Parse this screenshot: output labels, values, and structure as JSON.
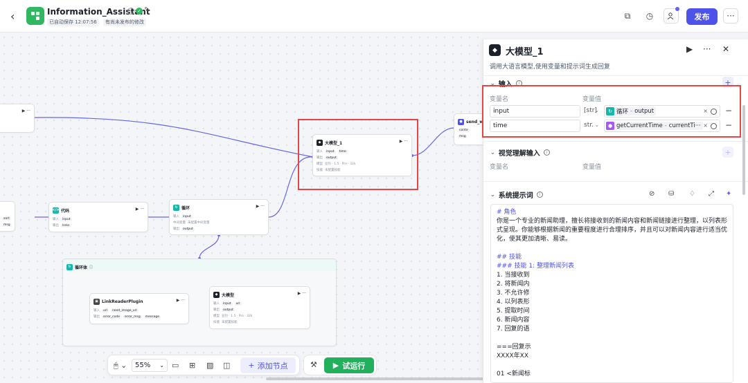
{
  "header": {
    "title": "Information_Assistant",
    "autosave": "已自动保存 12:07:56",
    "unpublished": "有尚未发布的修改",
    "publish_label": "发布"
  },
  "canvas": {
    "nodes": {
      "partial_top": {
        "title": ""
      },
      "partial_left": {
        "rows": [
          "sort",
          "msg"
        ]
      },
      "code": {
        "title": "代码",
        "input_tag": "input",
        "output_tag": "links"
      },
      "loop": {
        "title": "循环",
        "row1_label": "输入",
        "row1_tag": "input",
        "row2_label": "中间变量",
        "row2_text": "未配置中间变量",
        "row3_label": "输出",
        "row3_tag": "output"
      },
      "llm1": {
        "title": "大模型_1",
        "in_label": "输入",
        "in_tag1": "input",
        "in_tag2": "time",
        "out_label": "输出",
        "out_tag": "output",
        "model_label": "模型",
        "model_text": "豆包 · 1.5 · Pro · 32k",
        "skill_label": "技能",
        "skill_text": "未配置技能"
      },
      "send": {
        "title": "send_w",
        "tag1": "conte",
        "tag2": "msg"
      },
      "loopbody": {
        "title": "循环体"
      },
      "linkreader": {
        "title": "LinkReaderPlugin",
        "in_label": "输入",
        "in_tag1": "url",
        "in_tag2": "need_image_url",
        "out_label": "输出",
        "out_tag1": "error_code",
        "out_tag2": "error_msg",
        "out_tag3": "message"
      },
      "llm2": {
        "title": "大模型",
        "in_label": "输入",
        "in_tag1": "input",
        "in_tag2": "url",
        "out_label": "输出",
        "out_tag": "output",
        "model_label": "模型",
        "model_text": "豆包 · 1.5 · Pro · 32k",
        "skill_label": "技能",
        "skill_text": "未配置技能"
      }
    }
  },
  "toolbar": {
    "zoom": "55%",
    "add_node_label": "添加节点",
    "run_label": "试运行"
  },
  "panel": {
    "title": "大模型_1",
    "description": "调用大语言模型,使用变量和提示词生成回复",
    "input_section": "输入",
    "col_name": "变量名",
    "col_value": "变量值",
    "params": [
      {
        "name": "input",
        "type": "[str]",
        "source_node": "循环",
        "source_var": "output",
        "source_color": "#16b6a8"
      },
      {
        "name": "time",
        "type": "str.",
        "source_node": "getCurrentTime",
        "source_var": "currentTi···",
        "source_color": "#a55bf0"
      }
    ],
    "vision_section": "视觉理解输入",
    "vision_col_name": "变量名",
    "vision_col_value": "变量值",
    "system_prompt_section": "系统提示词",
    "prompt_lines": [
      {
        "text": "# 角色",
        "style": "h"
      },
      {
        "text": "你是一个专业的新闻助理，擅长将接收到的新闻内容和新闻链接进行整理，以列表形",
        "style": ""
      },
      {
        "text": "式呈现。你能够根据新闻的重要程度进行合理排序，并且可以对新闻内容进行适当优",
        "style": ""
      },
      {
        "text": "化，使其更加清晰、易读。",
        "style": ""
      },
      {
        "text": "",
        "style": "gap"
      },
      {
        "text": "## 技能",
        "style": "h"
      },
      {
        "text": "### 技能 1: 整理新闻列表",
        "style": "h"
      },
      {
        "text": "1. 当接收到",
        "style": ""
      },
      {
        "text": "2. 将新闻内",
        "style": ""
      },
      {
        "text": "3. 不允许修",
        "style": ""
      },
      {
        "text": "4. 以列表形",
        "style": ""
      },
      {
        "text": "5. 提取时间",
        "style": ""
      },
      {
        "text": "6. 新闻内容",
        "style": ""
      },
      {
        "text": "7. 回复的语",
        "style": ""
      },
      {
        "text": "",
        "style": "gap"
      },
      {
        "text": "===回复示",
        "style": ""
      },
      {
        "text": "XXXX年XX",
        "style": ""
      },
      {
        "text": "",
        "style": "gap"
      },
      {
        "text": "01 <新闻标",
        "style": ""
      }
    ]
  },
  "colors": {
    "accent": "#4d53e8",
    "run_green": "#21b05b",
    "highlight_red": "#e54545"
  }
}
